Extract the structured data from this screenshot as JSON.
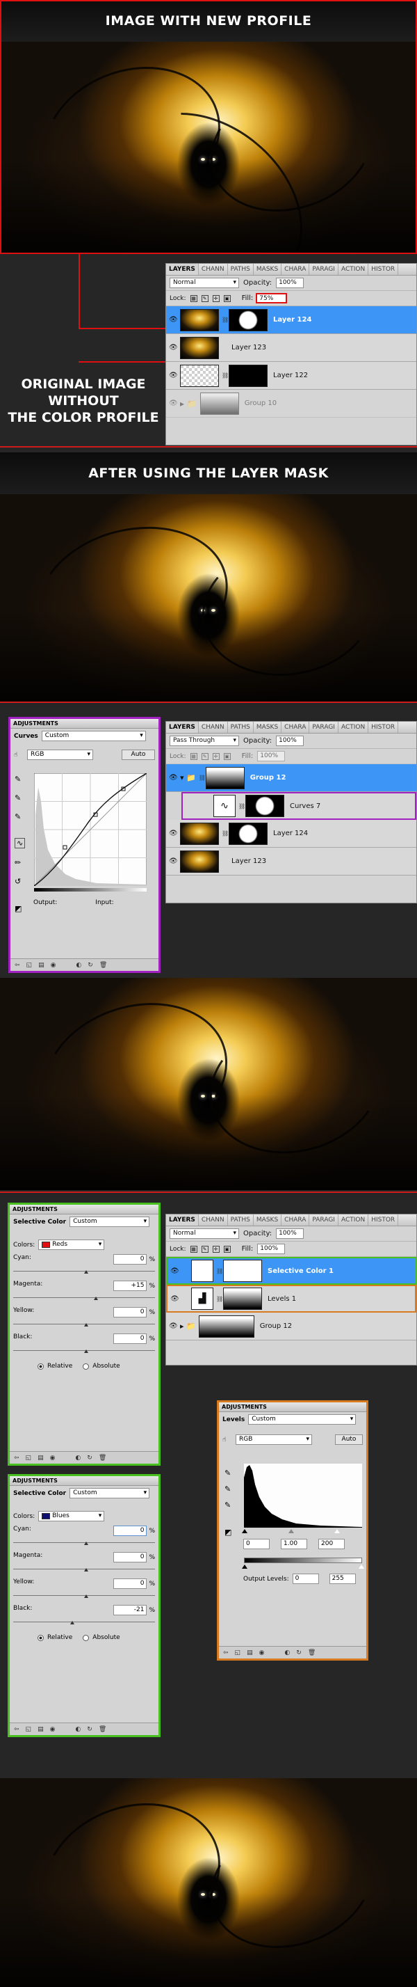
{
  "headings": {
    "image_with_new_profile": "IMAGE WITH NEW PROFILE",
    "original_line1": "ORIGINAL IMAGE",
    "original_line2": "WITHOUT",
    "original_line3": "THE COLOR PROFILE",
    "after_layer_mask": "AFTER USING THE LAYER MASK"
  },
  "layers_panel_1": {
    "tabs": [
      "LAYERS",
      "CHANN",
      "PATHS",
      "MASKS",
      "CHARA",
      "PARAGI",
      "ACTION",
      "HISTOR"
    ],
    "blend_mode": "Normal",
    "opacity_label": "Opacity:",
    "opacity_value": "100%",
    "lock_label": "Lock:",
    "fill_label": "Fill:",
    "fill_value": "75%",
    "layers": [
      {
        "name": "Layer 124"
      },
      {
        "name": "Layer 123"
      },
      {
        "name": "Layer 122"
      },
      {
        "name": "Group 10"
      }
    ]
  },
  "curves_panel": {
    "title": "ADJUSTMENTS",
    "name": "Curves",
    "preset": "Custom",
    "channel": "RGB",
    "auto_label": "Auto",
    "output_label": "Output:",
    "input_label": "Input:"
  },
  "layers_panel_2": {
    "tabs": [
      "LAYERS",
      "CHANN",
      "PATHS",
      "MASKS",
      "CHARA",
      "PARAGI",
      "ACTION",
      "HISTOR"
    ],
    "blend_mode": "Pass Through",
    "opacity_label": "Opacity:",
    "opacity_value": "100%",
    "lock_label": "Lock:",
    "fill_label": "Fill:",
    "fill_value": "100%",
    "layers": [
      {
        "name": "Group 12"
      },
      {
        "name": "Curves 7"
      },
      {
        "name": "Layer 124"
      },
      {
        "name": "Layer 123"
      }
    ]
  },
  "selective_color_reds": {
    "title": "ADJUSTMENTS",
    "name": "Selective Color",
    "preset": "Custom",
    "colors_label": "Colors:",
    "colors_value": "Reds",
    "cyan_label": "Cyan:",
    "cyan_value": "0",
    "magenta_label": "Magenta:",
    "magenta_value": "+15",
    "yellow_label": "Yellow:",
    "yellow_value": "0",
    "black_label": "Black:",
    "black_value": "0",
    "relative_label": "Relative",
    "absolute_label": "Absolute",
    "pct": "%"
  },
  "layers_panel_3": {
    "tabs": [
      "LAYERS",
      "CHANN",
      "PATHS",
      "MASKS",
      "CHARA",
      "PARAGI",
      "ACTION",
      "HISTOR"
    ],
    "blend_mode": "Normal",
    "opacity_label": "Opacity:",
    "opacity_value": "100%",
    "lock_label": "Lock:",
    "fill_label": "Fill:",
    "fill_value": "100%",
    "layers": [
      {
        "name": "Selective Color 1"
      },
      {
        "name": "Levels 1"
      },
      {
        "name": "Group 12"
      }
    ]
  },
  "levels_panel": {
    "title": "ADJUSTMENTS",
    "name": "Levels",
    "preset": "Custom",
    "channel": "RGB",
    "auto_label": "Auto",
    "input_black": "0",
    "input_gamma": "1.00",
    "input_white": "200",
    "output_label": "Output Levels:",
    "output_black": "0",
    "output_white": "255"
  },
  "selective_color_blues": {
    "title": "ADJUSTMENTS",
    "name": "Selective Color",
    "preset": "Custom",
    "colors_label": "Colors:",
    "colors_value": "Blues",
    "cyan_label": "Cyan:",
    "cyan_value": "0",
    "magenta_label": "Magenta:",
    "magenta_value": "0",
    "yellow_label": "Yellow:",
    "yellow_value": "0",
    "black_label": "Black:",
    "black_value": "-21",
    "relative_label": "Relative",
    "absolute_label": "Absolute",
    "pct": "%"
  },
  "colors": {
    "highlight_red": "#e01010",
    "layer_selected": "#3d96f5",
    "curves_border": "#a020c0",
    "selective_border": "#48c020",
    "levels_border": "#d87a20",
    "reds_swatch": "#e01010",
    "blues_swatch": "#101070"
  },
  "icons": [
    "eye-icon",
    "chain-icon",
    "folder-icon",
    "curves-icon",
    "levels-icon",
    "selective-color-icon",
    "eyedropper-icon",
    "lock-icon"
  ]
}
